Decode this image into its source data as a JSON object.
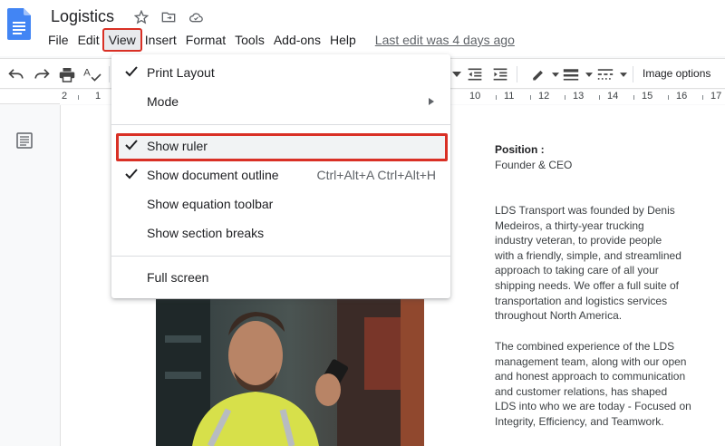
{
  "header": {
    "doc_title": "Logistics",
    "icons": [
      "star-icon",
      "move-to-folder-icon",
      "cloud-status-icon"
    ],
    "menu": [
      "File",
      "Edit",
      "View",
      "Insert",
      "Format",
      "Tools",
      "Add-ons",
      "Help"
    ],
    "active_menu": "View",
    "last_edit": "Last edit was 4 days ago"
  },
  "toolbar": {
    "image_options": "Image options"
  },
  "ruler": {
    "numbers": [
      "2",
      "1",
      "10",
      "11",
      "12",
      "13",
      "14",
      "15",
      "16",
      "17"
    ]
  },
  "view_menu": {
    "items": [
      {
        "label": "Print Layout",
        "checked": true,
        "shortcut": "",
        "submenu": false
      },
      {
        "label": "Mode",
        "checked": false,
        "shortcut": "",
        "submenu": true
      },
      {
        "label": "Show ruler",
        "checked": true,
        "shortcut": "",
        "submenu": false,
        "highlighted": true
      },
      {
        "label": "Show document outline",
        "checked": true,
        "shortcut": "Ctrl+Alt+A Ctrl+Alt+H",
        "submenu": false
      },
      {
        "label": "Show equation toolbar",
        "checked": false,
        "shortcut": "",
        "submenu": false
      },
      {
        "label": "Show section breaks",
        "checked": false,
        "shortcut": "",
        "submenu": false
      },
      {
        "label": "Full screen",
        "checked": false,
        "shortcut": "",
        "submenu": false
      }
    ]
  },
  "document": {
    "position_label": "Position      :",
    "position_value": "Founder & CEO",
    "paragraph1": [
      "LDS Transport was founded by Denis",
      "Medeiros, a thirty-year trucking",
      "industry veteran, to provide people",
      "with a friendly, simple, and streamlined",
      "approach to taking care of all your",
      "shipping needs. We offer a full suite of",
      "transportation and logistics services",
      "throughout North America."
    ],
    "paragraph2": [
      "The combined experience of the LDS",
      "management team, along with our open",
      "and honest approach to communication",
      "and customer relations, has shaped",
      "LDS into who we are today - Focused on",
      "Integrity, Efficiency, and Teamwork."
    ]
  },
  "colors": {
    "highlight_red": "#d93025",
    "docs_blue": "#4285f4"
  }
}
